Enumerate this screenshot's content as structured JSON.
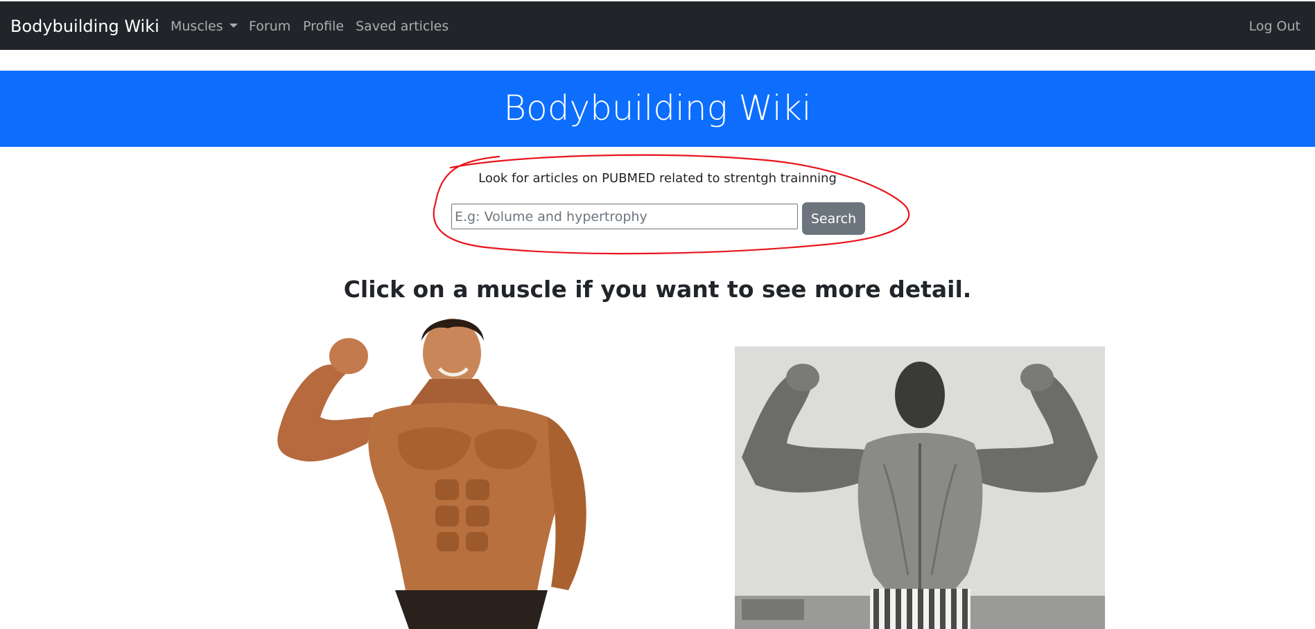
{
  "navbar": {
    "brand": "Bodybuilding Wiki",
    "links": {
      "muscles": "Muscles",
      "forum": "Forum",
      "profile": "Profile",
      "saved": "Saved articles",
      "logout": "Log Out"
    }
  },
  "hero": {
    "title": "Bodybuilding Wiki"
  },
  "search": {
    "prompt": "Look for articles on PUBMED related to strentgh trainning",
    "placeholder": "E.g: Volume and hypertrophy",
    "value": "",
    "button_label": "Search"
  },
  "instruction": "Click on a muscle if you want to see more detail.",
  "colors": {
    "navbar_bg": "#212529",
    "hero_bg": "#0d6efd",
    "button_bg": "#6c757d",
    "annotation": "#e8141c"
  },
  "images": {
    "front": "front-pose-photo",
    "back": "back-double-biceps-photo"
  }
}
